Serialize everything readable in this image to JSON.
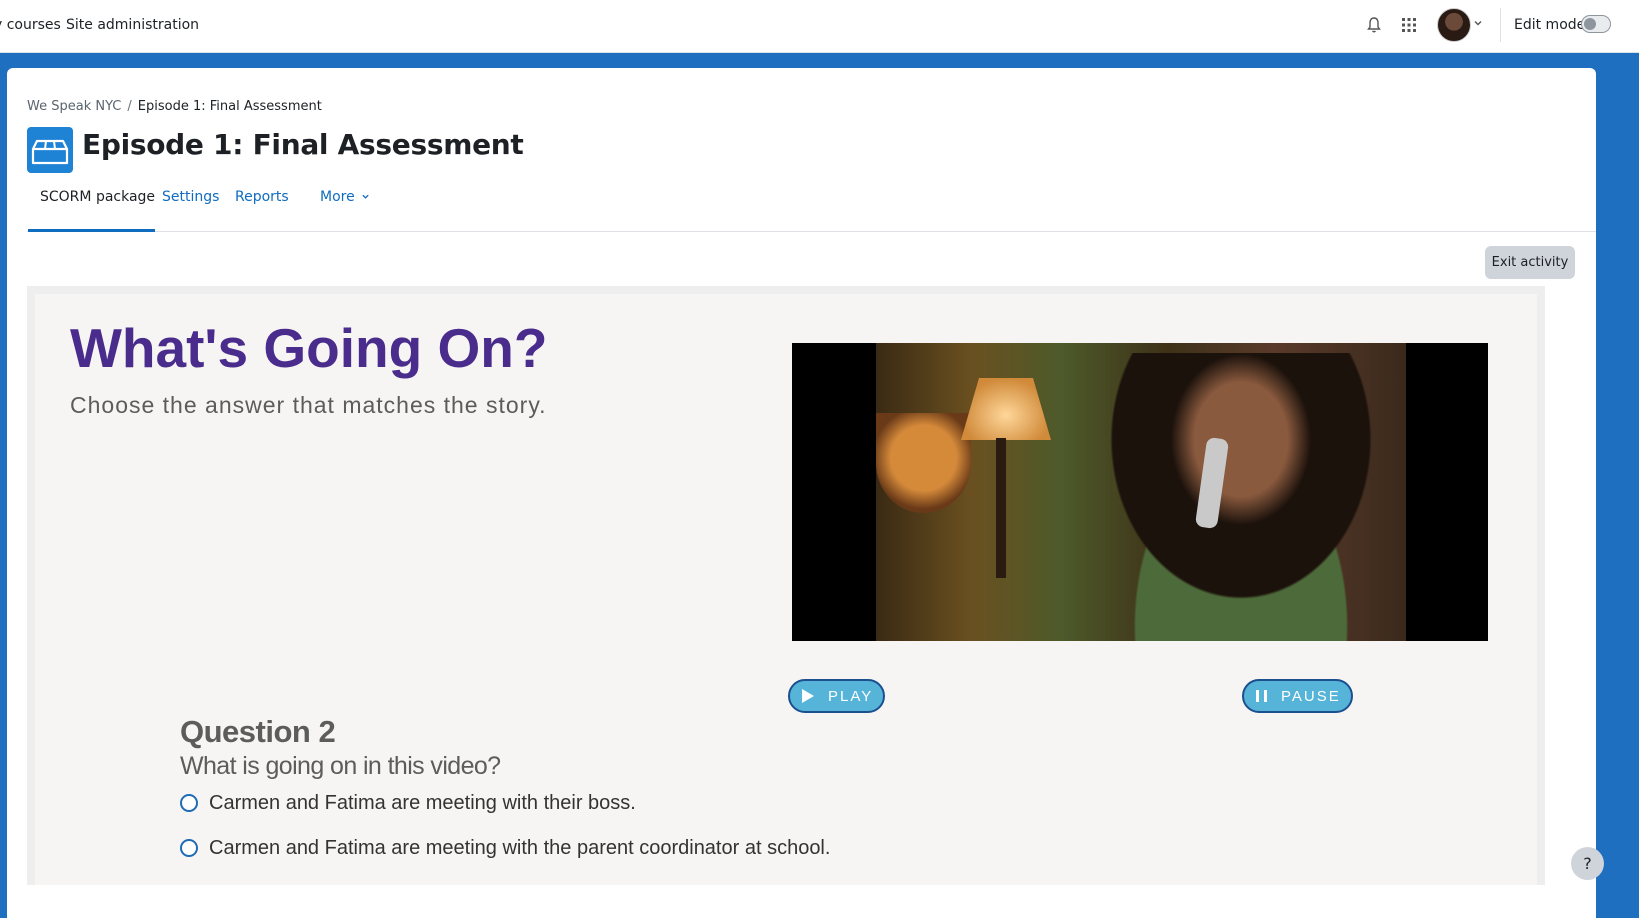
{
  "topbar": {
    "nav_links": [
      "y courses",
      "Site administration"
    ],
    "edit_mode_label": "Edit mode"
  },
  "breadcrumb": {
    "items": [
      "We Speak NYC",
      "Episode 1: Final Assessment"
    ],
    "separator": "/"
  },
  "page": {
    "title": "Episode 1: Final Assessment"
  },
  "tabs": [
    {
      "label": "SCORM package",
      "active": true
    },
    {
      "label": "Settings",
      "active": false
    },
    {
      "label": "Reports",
      "active": false
    },
    {
      "label": "More",
      "active": false
    }
  ],
  "exit_button": "Exit activity",
  "help_button": "?",
  "scorm": {
    "title": "What's Going On?",
    "subtitle": "Choose the answer that matches the story.",
    "play_label": "PLAY",
    "pause_label": "PAUSE",
    "question": {
      "title": "Question 2",
      "text": "What is going on in this video?",
      "options": [
        "Carmen and Fatima are meeting with their boss.",
        "Carmen and Fatima are meeting with the parent coordinator at school."
      ]
    }
  },
  "colors": {
    "page_background": "#1e6fc0",
    "accent_link": "#0f6cbf",
    "scorm_title": "#4a2c8c",
    "pill_button": "#55b4d8",
    "activity_icon": "#1f83d5"
  },
  "icons": [
    "bell-icon",
    "apps-grid-icon",
    "chevron-down-icon",
    "scorm-package-icon",
    "play-icon",
    "pause-icon"
  ]
}
